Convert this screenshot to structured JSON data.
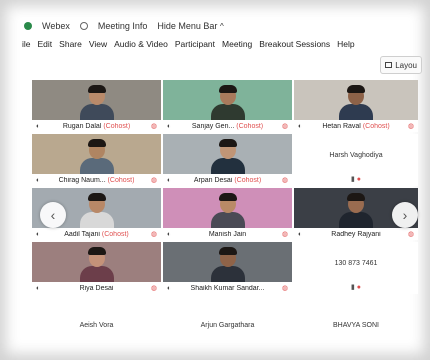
{
  "titlebar": {
    "app_name": "Webex",
    "meeting_info": "Meeting Info",
    "hide_menu": "Hide Menu Bar",
    "hide_menu_chevron": "^"
  },
  "menubar": {
    "items": [
      "ile",
      "Edit",
      "Share",
      "View",
      "Audio & Video",
      "Participant",
      "Meeting",
      "Breakout Sessions",
      "Help"
    ]
  },
  "toolbar": {
    "layout_label": "Layou",
    "layout_icon": "grid-layout-icon"
  },
  "tiles": [
    {
      "name": "Rugan Dalal",
      "tag": "(Cohost)",
      "video": true,
      "bg": "#8f8a82",
      "shirt": "#3f4a5a",
      "skin": "#b98a6a"
    },
    {
      "name": "Sanjay Gen...",
      "tag": "(Cohost)",
      "video": true,
      "bg": "#7fb39a",
      "shirt": "#2f3a30",
      "skin": "#a87a5c"
    },
    {
      "name": "Hetan Raval",
      "tag": "(Cohost)",
      "video": true,
      "bg": "#c9c4bc",
      "shirt": "#2e3b50",
      "skin": "#8d6248"
    },
    {
      "name": "Chirag Naum...",
      "tag": "(Cohost)",
      "video": true,
      "bg": "#b9a88f",
      "shirt": "#5a6a7a",
      "skin": "#b08562"
    },
    {
      "name": "Arpan Desai",
      "tag": "(Cohost)",
      "video": true,
      "bg": "#a9b0b4",
      "shirt": "#22303e",
      "skin": "#c09576"
    },
    {
      "name": "Harsh Vaghodiya",
      "tag": "",
      "video": false
    },
    {
      "name": "Aadil Tajani",
      "tag": "(Cohost)",
      "video": true,
      "bg": "#a3aab0",
      "shirt": "#d8d8d8",
      "skin": "#b88867"
    },
    {
      "name": "Manish Jain",
      "tag": "",
      "video": true,
      "bg": "#cf8fb8",
      "shirt": "#4a4a55",
      "skin": "#b98a66"
    },
    {
      "name": "Radhey Rajyani",
      "tag": "",
      "video": true,
      "bg": "#3b3f46",
      "shirt": "#1f252e",
      "skin": "#9a6c50"
    },
    {
      "name": "Riya Desai",
      "tag": "",
      "video": true,
      "bg": "#9c7f7e",
      "shirt": "#6c3e4a",
      "skin": "#c49279"
    },
    {
      "name": "Shaikh Kumar Sandar...",
      "tag": "",
      "video": true,
      "bg": "#6a6f74",
      "shirt": "#2c313a",
      "skin": "#8f6348"
    },
    {
      "name": "130 873 7461",
      "tag": "",
      "video": false
    }
  ],
  "bottom_names": [
    "Aeish Vora",
    "Arjun Gargathara",
    "BHAVYA SONI"
  ],
  "nav": {
    "prev": "‹",
    "next": "›"
  },
  "icons": {
    "mic": "🎙",
    "rec": "●",
    "cam": "▮",
    "rec_small": "●"
  }
}
